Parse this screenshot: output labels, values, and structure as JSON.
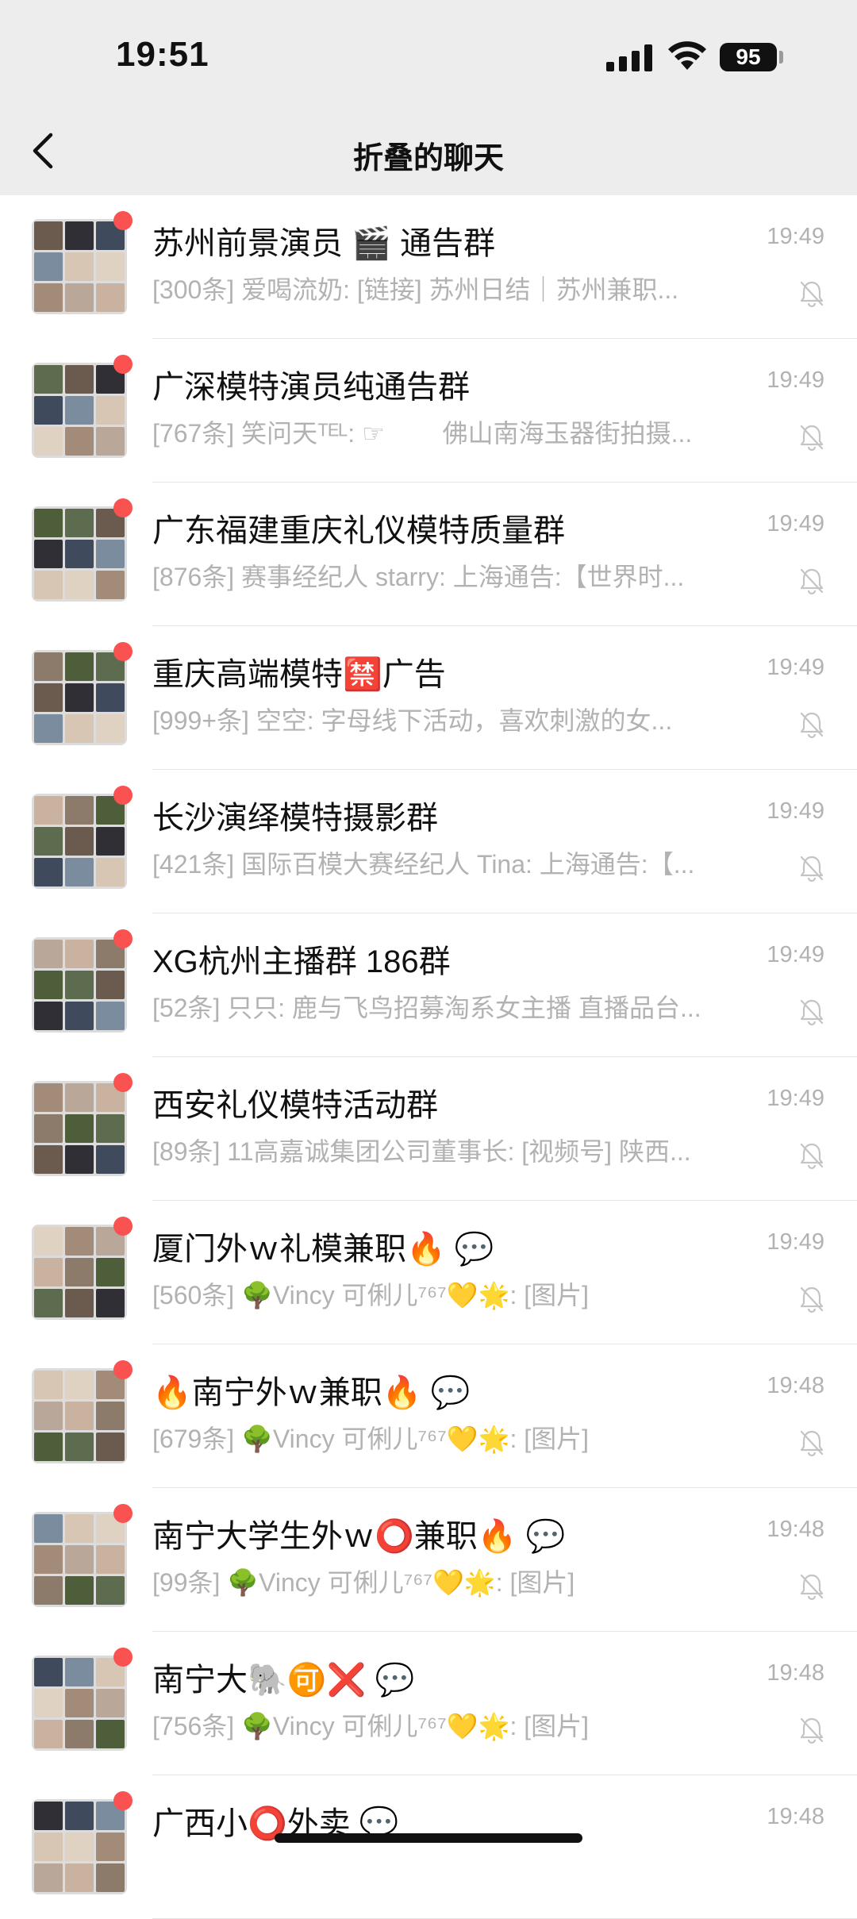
{
  "status": {
    "time": "19:51",
    "battery": "95"
  },
  "nav": {
    "title": "折叠的聊天"
  },
  "chats": [
    {
      "name": "苏州前景演员 🎬 通告群",
      "preview": "[300条] 爱喝流奶: [链接] 苏州日结｜苏州兼职...",
      "time": "19:49"
    },
    {
      "name": "广深模特演员纯通告群",
      "preview": "[767条] 笑问天ᵀᴱᴸ: ☞ 　　佛山南海玉器街拍摄...",
      "time": "19:49"
    },
    {
      "name": "广东福建重庆礼仪模特质量群",
      "preview": "[876条] 赛事经纪人 starry: 上海通告:【世界时...",
      "time": "19:49"
    },
    {
      "name": "重庆高端模特🈲广告",
      "preview": "[999+条] 空空: 字母线下活动，喜欢刺激的女...",
      "time": "19:49"
    },
    {
      "name": "长沙演绎模特摄影群",
      "preview": "[421条] 国际百模大赛经纪人 Tina: 上海通告:【...",
      "time": "19:49"
    },
    {
      "name": "XG杭州主播群 186群",
      "preview": "[52条] 只只: 鹿与飞鸟招募淘系女主播 直播品台...",
      "time": "19:49"
    },
    {
      "name": "西安礼仪模特活动群",
      "preview": "[89条] 11高嘉诚集团公司董事长: [视频号] 陕西...",
      "time": "19:49"
    },
    {
      "name": "厦门外ｗ礼模兼职🔥 💬",
      "preview": "[560条] 🌳Vincy 可俐儿⁷⁶⁷💛🌟: [图片]",
      "time": "19:49"
    },
    {
      "name": "🔥南宁外ｗ兼职🔥 💬",
      "preview": "[679条] 🌳Vincy 可俐儿⁷⁶⁷💛🌟: [图片]",
      "time": "19:48"
    },
    {
      "name": "南宁大学生外ｗ⭕兼职🔥 💬",
      "preview": "[99条] 🌳Vincy 可俐儿⁷⁶⁷💛🌟: [图片]",
      "time": "19:48"
    },
    {
      "name": "南宁大🐘🉑❌ 💬",
      "preview": "[756条] 🌳Vincy 可俐儿⁷⁶⁷💛🌟: [图片]",
      "time": "19:48"
    },
    {
      "name": "广西小⭕外卖 💬",
      "preview": "",
      "time": "19:48"
    }
  ]
}
